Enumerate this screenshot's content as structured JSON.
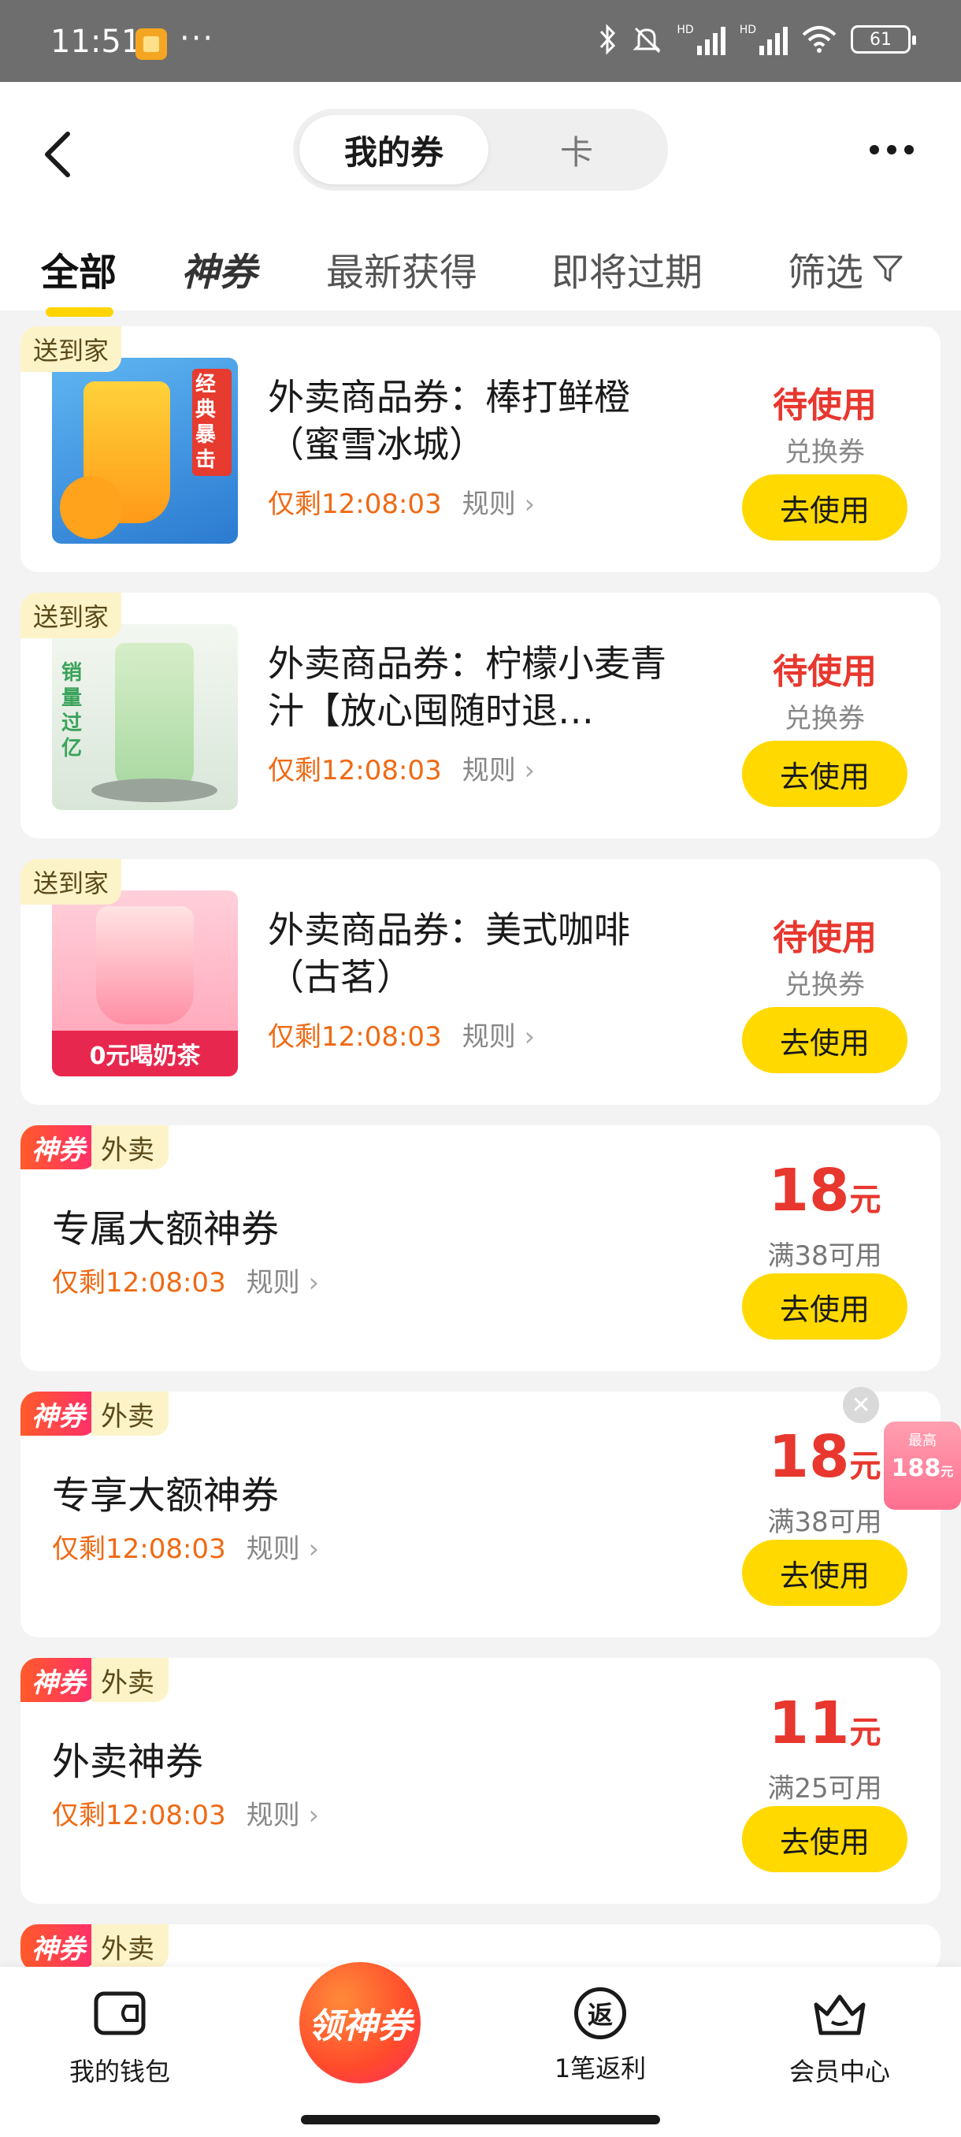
{
  "status_bar": {
    "time": "11:51",
    "dots": "···",
    "hd1": "HD",
    "hd2": "HD",
    "battery": "61"
  },
  "header": {
    "segments": {
      "active": "我的券",
      "inactive": "卡"
    }
  },
  "tabs": {
    "all": "全部",
    "shenquan": "神券",
    "latest": "最新获得",
    "expiring": "即将过期",
    "filter": "筛选"
  },
  "products": [
    {
      "tag": "送到家",
      "title": "外卖商品券：棒打鲜橙（蜜雪冰城）",
      "countdown": "仅剩12:08:03",
      "rules": "规则",
      "status": "待使用",
      "type": "兑换券",
      "button": "去使用",
      "thumb_text": "经典暴击"
    },
    {
      "tag": "送到家",
      "title": "外卖商品券：柠檬小麦青汁【放心囤随时退…",
      "countdown": "仅剩12:08:03",
      "rules": "规则",
      "status": "待使用",
      "type": "兑换券",
      "button": "去使用",
      "thumb_text": "销量过亿"
    },
    {
      "tag": "送到家",
      "title": "外卖商品券：美式咖啡（古茗）",
      "countdown": "仅剩12:08:03",
      "rules": "规则",
      "status": "待使用",
      "type": "兑换券",
      "button": "去使用",
      "thumb_text": "0元喝奶茶"
    }
  ],
  "vouchers": [
    {
      "badge_a": "神券",
      "badge_b": "外卖",
      "title": "专属大额神券",
      "countdown": "仅剩12:08:03",
      "rules": "规则",
      "amount": "18",
      "unit": "元",
      "condition": "满38可用",
      "button": "去使用"
    },
    {
      "badge_a": "神券",
      "badge_b": "外卖",
      "title": "专享大额神券",
      "countdown": "仅剩12:08:03",
      "rules": "规则",
      "amount": "18",
      "unit": "元",
      "condition": "满38可用",
      "button": "去使用"
    },
    {
      "badge_a": "神券",
      "badge_b": "外卖",
      "title": "外卖神券",
      "countdown": "仅剩12:08:03",
      "rules": "规则",
      "amount": "11",
      "unit": "元",
      "condition": "满25可用",
      "button": "去使用"
    },
    {
      "badge_a": "神券",
      "badge_b": "外卖"
    }
  ],
  "floating_promo": {
    "top": "最高",
    "amount": "188",
    "unit": "元"
  },
  "bottom_nav": {
    "wallet": "我的钱包",
    "center": "领神券",
    "rebate_icon": "返",
    "rebate": "1笔返利",
    "member": "会员中心"
  },
  "colors": {
    "accent": "#ffd900",
    "price": "#e8372e",
    "countdown": "#ef6a14"
  }
}
